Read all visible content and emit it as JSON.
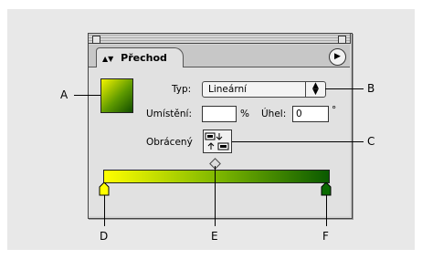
{
  "panel": {
    "tab_title": "Přechod",
    "tab_icon": "tab-arrows-icon",
    "menu_icon": "panel-menu-icon"
  },
  "fields": {
    "typ_label": "Typ:",
    "typ_value": "Lineární",
    "position_label": "Umístění:",
    "position_value": "",
    "position_unit": "%",
    "angle_label": "Úhel:",
    "angle_value": "0",
    "angle_unit": "°",
    "reverse_label": "Obrácený"
  },
  "gradient": {
    "start_color": "#ffff00",
    "mid_color": "#7fb800",
    "end_color": "#0a5a00",
    "midpoint_percent": 50
  },
  "callouts": {
    "A": "A",
    "B": "B",
    "C": "C",
    "D": "D",
    "E": "E",
    "F": "F"
  }
}
